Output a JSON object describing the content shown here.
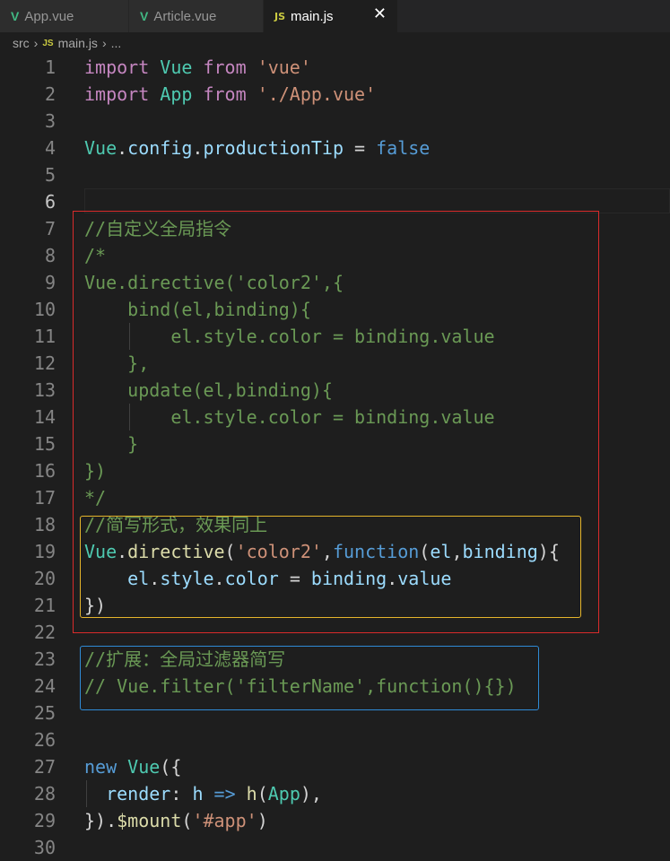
{
  "tabs": [
    {
      "icon": "V",
      "label": "App.vue"
    },
    {
      "icon": "V",
      "label": "Article.vue"
    },
    {
      "icon": "JS",
      "label": "main.js",
      "close": "✕"
    }
  ],
  "breadcrumb": {
    "folder": "src",
    "file_icon": "JS",
    "file": "main.js",
    "rest": "..."
  },
  "lines": [
    {
      "n": "1",
      "tokens": [
        [
          "import",
          "kw"
        ],
        [
          " ",
          "pl"
        ],
        [
          "Vue",
          "vue"
        ],
        [
          " ",
          "pl"
        ],
        [
          "from",
          "kw"
        ],
        [
          " ",
          "pl"
        ],
        [
          "'vue'",
          "str"
        ]
      ]
    },
    {
      "n": "2",
      "tokens": [
        [
          "import",
          "kw"
        ],
        [
          " ",
          "pl"
        ],
        [
          "App",
          "vue"
        ],
        [
          " ",
          "pl"
        ],
        [
          "from",
          "kw"
        ],
        [
          " ",
          "pl"
        ],
        [
          "'./App.vue'",
          "str"
        ]
      ]
    },
    {
      "n": "3",
      "tokens": []
    },
    {
      "n": "4",
      "tokens": [
        [
          "Vue",
          "vue"
        ],
        [
          ".",
          "pl"
        ],
        [
          "config",
          "prop"
        ],
        [
          ".",
          "pl"
        ],
        [
          "productionTip",
          "prop"
        ],
        [
          " = ",
          "pl"
        ],
        [
          "false",
          "bl"
        ]
      ]
    },
    {
      "n": "5",
      "tokens": []
    },
    {
      "n": "6",
      "tokens": []
    },
    {
      "n": "7",
      "tokens": [
        [
          "//自定义全局指令",
          "cmt"
        ]
      ]
    },
    {
      "n": "8",
      "tokens": [
        [
          "/*",
          "cmt"
        ]
      ]
    },
    {
      "n": "9",
      "tokens": [
        [
          "Vue.directive('color2',{",
          "cmt"
        ]
      ]
    },
    {
      "n": "10",
      "tokens": [
        [
          "    bind(el,binding){",
          "cmt"
        ]
      ]
    },
    {
      "n": "11",
      "tokens": [
        [
          "        el.style.color = binding.value",
          "cmt"
        ]
      ]
    },
    {
      "n": "12",
      "tokens": [
        [
          "    },",
          "cmt"
        ]
      ]
    },
    {
      "n": "13",
      "tokens": [
        [
          "    update(el,binding){",
          "cmt"
        ]
      ]
    },
    {
      "n": "14",
      "tokens": [
        [
          "        el.style.color = binding.value",
          "cmt"
        ]
      ]
    },
    {
      "n": "15",
      "tokens": [
        [
          "    }",
          "cmt"
        ]
      ]
    },
    {
      "n": "16",
      "tokens": [
        [
          "})",
          "cmt"
        ]
      ]
    },
    {
      "n": "17",
      "tokens": [
        [
          "*/",
          "cmt"
        ]
      ]
    },
    {
      "n": "18",
      "tokens": [
        [
          "//简写形式，效果同上",
          "cmt"
        ]
      ]
    },
    {
      "n": "19",
      "tokens": [
        [
          "Vue",
          "vue"
        ],
        [
          ".",
          "pl"
        ],
        [
          "directive",
          "fn"
        ],
        [
          "(",
          "pl"
        ],
        [
          "'color2'",
          "str"
        ],
        [
          ",",
          "pl"
        ],
        [
          "function",
          "bl"
        ],
        [
          "(",
          "pl"
        ],
        [
          "el",
          "prop"
        ],
        [
          ",",
          "pl"
        ],
        [
          "binding",
          "prop"
        ],
        [
          "){",
          "pl"
        ]
      ]
    },
    {
      "n": "20",
      "tokens": [
        [
          "    ",
          "pl"
        ],
        [
          "el",
          "prop"
        ],
        [
          ".",
          "pl"
        ],
        [
          "style",
          "prop"
        ],
        [
          ".",
          "pl"
        ],
        [
          "color",
          "prop"
        ],
        [
          " = ",
          "pl"
        ],
        [
          "binding",
          "prop"
        ],
        [
          ".",
          "pl"
        ],
        [
          "value",
          "prop"
        ]
      ]
    },
    {
      "n": "21",
      "tokens": [
        [
          "})",
          "pl"
        ]
      ]
    },
    {
      "n": "22",
      "tokens": []
    },
    {
      "n": "23",
      "tokens": [
        [
          "//扩展：全局过滤器简写",
          "cmt"
        ]
      ]
    },
    {
      "n": "24",
      "tokens": [
        [
          "// Vue.filter('filterName',function(){})",
          "cmt"
        ]
      ]
    },
    {
      "n": "25",
      "tokens": []
    },
    {
      "n": "26",
      "tokens": []
    },
    {
      "n": "27",
      "tokens": [
        [
          "new",
          "bl"
        ],
        [
          " ",
          "pl"
        ],
        [
          "Vue",
          "vue"
        ],
        [
          "({",
          "pl"
        ]
      ]
    },
    {
      "n": "28",
      "tokens": [
        [
          "  ",
          "pl"
        ],
        [
          "render",
          "prop"
        ],
        [
          ": ",
          "pl"
        ],
        [
          "h",
          "prop"
        ],
        [
          " ",
          "pl"
        ],
        [
          "=>",
          "bl"
        ],
        [
          " ",
          "pl"
        ],
        [
          "h",
          "fn"
        ],
        [
          "(",
          "pl"
        ],
        [
          "App",
          "vue"
        ],
        [
          "),",
          "pl"
        ]
      ]
    },
    {
      "n": "29",
      "tokens": [
        [
          "})",
          "pl"
        ],
        [
          ".",
          "pl"
        ],
        [
          "$mount",
          "fn"
        ],
        [
          "(",
          "pl"
        ],
        [
          "'#app'",
          "str"
        ],
        [
          ")",
          "pl"
        ]
      ]
    },
    {
      "n": "30",
      "tokens": []
    }
  ],
  "colors": {
    "red_box": "#d92b2b",
    "yellow_box": "#e5b52b",
    "blue_box": "#2f8bd6"
  }
}
